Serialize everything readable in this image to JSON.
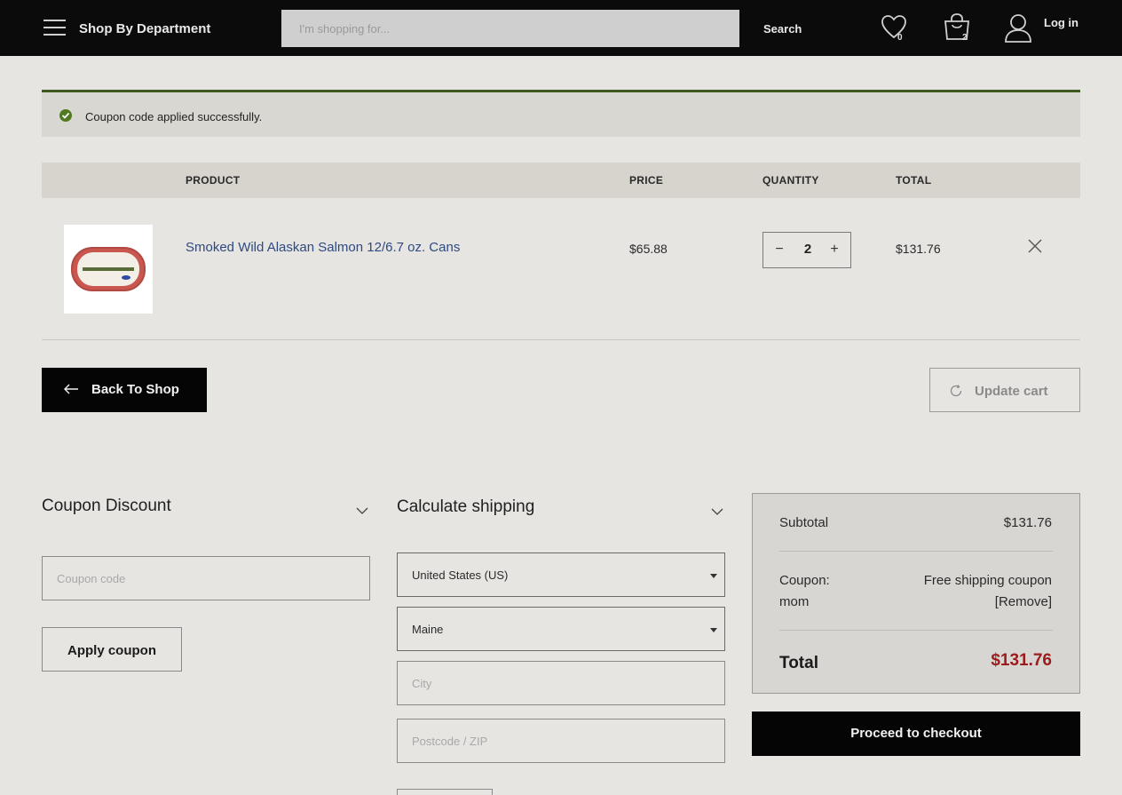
{
  "header": {
    "department_label": "Shop By Department",
    "search_placeholder": "I'm shopping for...",
    "search_label": "Search",
    "wishlist_count": "0",
    "cart_count": "2",
    "login_label": "Log in"
  },
  "notice": {
    "message": "Coupon code applied successfully."
  },
  "cart": {
    "columns": {
      "product": "PRODUCT",
      "price": "PRICE",
      "quantity": "QUANTITY",
      "total": "TOTAL"
    },
    "items": [
      {
        "name": "Smoked Wild Alaskan Salmon 12/6.7 oz. Cans",
        "price": "$65.88",
        "quantity": "2",
        "total": "$131.76"
      }
    ],
    "back_label": "Back To Shop",
    "update_label": "Update cart"
  },
  "coupon": {
    "title": "Coupon Discount",
    "placeholder": "Coupon code",
    "apply_label": "Apply coupon"
  },
  "shipping": {
    "title": "Calculate shipping",
    "country": "United States (US)",
    "state": "Maine",
    "city_placeholder": "City",
    "postcode_placeholder": "Postcode / ZIP"
  },
  "totals": {
    "subtotal_label": "Subtotal",
    "subtotal_value": "$131.76",
    "coupon_label_line1": "Coupon:",
    "coupon_label_line2": "mom",
    "coupon_value": "Free shipping coupon",
    "coupon_remove": "[Remove]",
    "total_label": "Total",
    "total_value": "$131.76",
    "checkout_label": "Proceed to checkout"
  },
  "colors": {
    "header_bg": "#0b0b0b",
    "accent_success": "#4f7a1f",
    "total_price": "#9c1b1b",
    "link": "#2f4a80"
  }
}
